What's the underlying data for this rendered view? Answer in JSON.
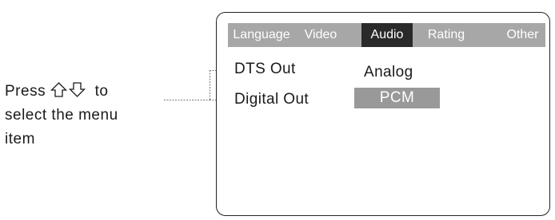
{
  "instruction": {
    "press": "Press",
    "up_icon": "up-arrow-outline-icon",
    "down_icon": "down-arrow-outline-icon",
    "to": "to",
    "line2": "select the menu",
    "line3": "item"
  },
  "menu": {
    "tabs": [
      {
        "label": "Language",
        "active": false
      },
      {
        "label": "Video",
        "active": false
      },
      {
        "label": "Audio",
        "active": true
      },
      {
        "label": "Rating",
        "active": false
      },
      {
        "label": "Other",
        "active": false
      }
    ],
    "items": [
      {
        "label": "DTS Out",
        "value": "Analog",
        "selected": false
      },
      {
        "label": "Digital Out",
        "value": "PCM",
        "selected": true
      }
    ]
  },
  "colors": {
    "tabbar": "#a7a7a7",
    "active_tab": "#2a2a2a",
    "selected_value": "#999999",
    "callout_line": "#777777"
  }
}
